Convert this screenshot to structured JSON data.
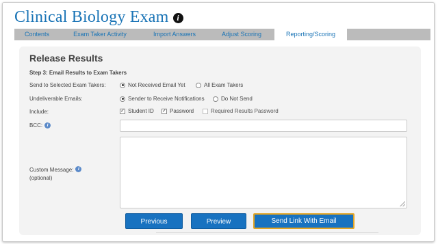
{
  "header": {
    "title": "Clinical Biology Exam"
  },
  "tabs": [
    {
      "label": "Contents"
    },
    {
      "label": "Exam Taker Activity"
    },
    {
      "label": "Import Answers"
    },
    {
      "label": "Adjust Scoring"
    },
    {
      "label": "Reporting/Scoring",
      "active": true
    }
  ],
  "panel": {
    "heading": "Release Results",
    "step": "Step 3: Email Results to Exam Takers",
    "send_to": {
      "label": "Send to Selected Exam Takers:",
      "options": [
        "Not Received Email Yet",
        "All Exam Takers"
      ],
      "selected": "Not Received Email Yet"
    },
    "undeliverable": {
      "label": "Undeliverable Emails:",
      "options": [
        "Sender to Receive Notifications",
        "Do Not Send"
      ],
      "selected": "Sender to Receive Notifications"
    },
    "include": {
      "label": "Include:",
      "options": [
        {
          "label": "Student ID",
          "checked": true
        },
        {
          "label": "Password",
          "checked": true
        },
        {
          "label": "Required Results Password",
          "checked": false
        }
      ]
    },
    "bcc": {
      "label": "BCC:",
      "value": ""
    },
    "custom_message": {
      "label": "Custom Message:",
      "sublabel": "(optional)",
      "value": ""
    },
    "buttons": {
      "previous": "Previous",
      "preview": "Preview",
      "send": "Send Link With Email"
    }
  },
  "colors": {
    "title": "#1a74b6",
    "tab_bar": "#bbbbbb",
    "button": "#1872c0",
    "button_highlight": "#e3a525"
  }
}
